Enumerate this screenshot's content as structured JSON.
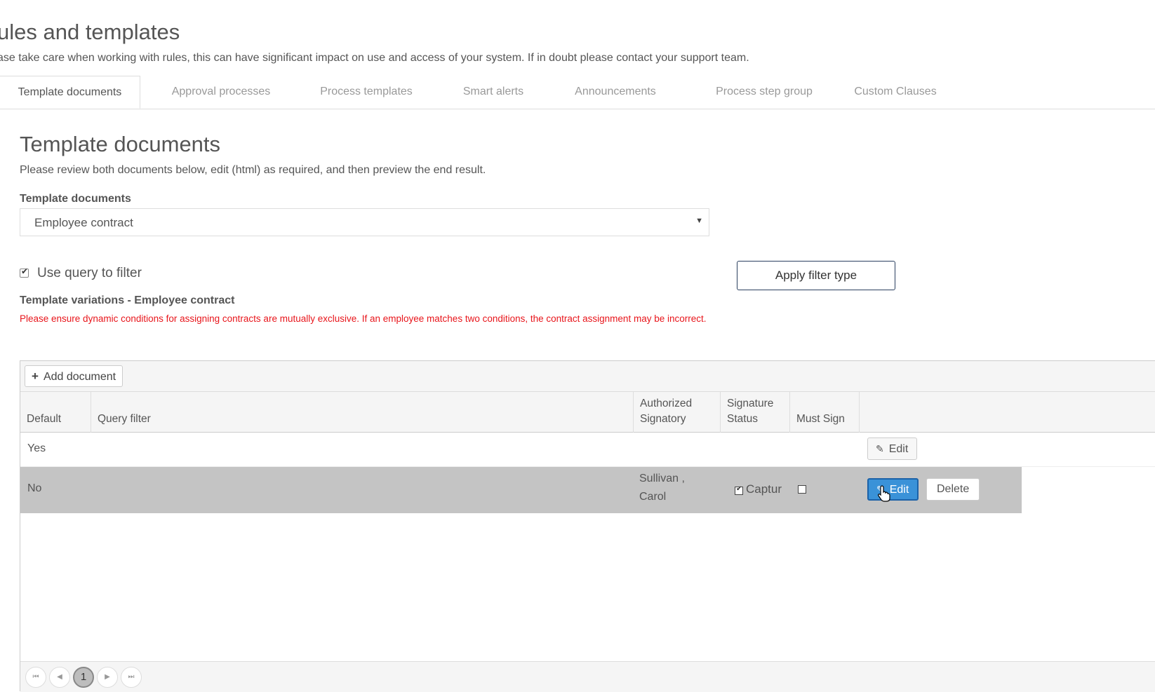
{
  "header": {
    "title": "ules and templates",
    "subtitle": "ase take care when working with rules, this can have significant impact on use and access of your system. If in doubt please contact your support team."
  },
  "tabs": [
    {
      "label": "Template documents",
      "active": true
    },
    {
      "label": "Approval processes",
      "active": false
    },
    {
      "label": "Process templates",
      "active": false
    },
    {
      "label": "Smart alerts",
      "active": false
    },
    {
      "label": "Announcements",
      "active": false
    },
    {
      "label": "Process step group",
      "active": false
    },
    {
      "label": "Custom Clauses",
      "active": false
    }
  ],
  "section": {
    "title": "Template documents",
    "description": "Please review both documents below, edit (html) as required, and then preview the end result.",
    "select_label": "Template documents",
    "select_value": "Employee contract",
    "use_query_label": "Use query to filter",
    "use_query_checked": true,
    "apply_button": "Apply filter type",
    "variations_title": "Template variations - Employee contract",
    "warning": "Please ensure dynamic conditions for assigning contracts are mutually exclusive. If an employee matches two conditions, the contract assignment may be incorrect."
  },
  "grid": {
    "add_button": "Add document",
    "columns": [
      "Default",
      "Query filter",
      "Authorized Signatory",
      "Signature Status",
      "Must Sign",
      ""
    ],
    "rows": [
      {
        "default": "Yes",
        "query": "",
        "signatory_line1": "",
        "signatory_line2": "",
        "status": "",
        "edit": "Edit"
      },
      {
        "default": "No",
        "query": "",
        "signatory_line1": "Sullivan ,",
        "signatory_line2": "Carol",
        "status": "Captur",
        "edit": "Edit",
        "delete": "Delete"
      }
    ],
    "pager": {
      "current_page": "1"
    }
  },
  "colors": {
    "accent": "#3a92d8",
    "warning": "#e8151b",
    "selected_row": "#c4c4c4"
  }
}
